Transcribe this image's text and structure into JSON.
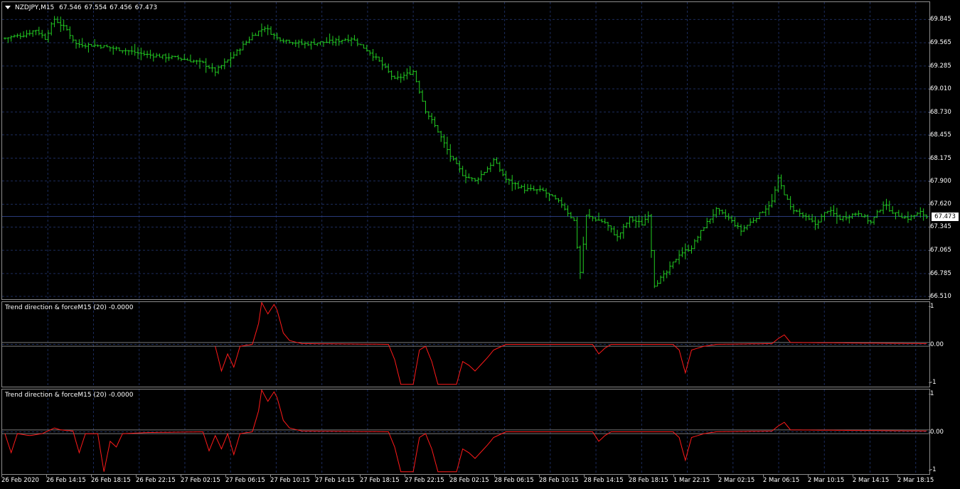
{
  "chart_header": {
    "symbol": "NZDJPY,M15",
    "open": "67.546",
    "high": "67.554",
    "low": "67.456",
    "close": "67.473"
  },
  "current_price": "67.473",
  "indicator_1": {
    "label": "Trend direction & forceM15 (20) -0.0000"
  },
  "indicator_2": {
    "label": "Trend direction & forceM15 (20) -0.0000"
  },
  "colors": {
    "background": "#000000",
    "grid": "#1c2c5c",
    "bars": "#22cc22",
    "indicator_line": "#ff1a1a",
    "level_line": "#7a7a7a",
    "price_line": "#2a3a7a"
  },
  "chart_data": [
    {
      "type": "ohlc",
      "symbol": "NZDJPY,M15",
      "ylim": [
        66.51,
        69.9
      ],
      "y_ticks": [
        "69.845",
        "69.565",
        "69.285",
        "69.010",
        "68.730",
        "68.455",
        "68.175",
        "67.900",
        "67.620",
        "67.345",
        "67.065",
        "66.785",
        "66.510"
      ],
      "x_ticks": [
        "26 Feb 2020",
        "26 Feb 14:15",
        "26 Feb 18:15",
        "26 Feb 22:15",
        "27 Feb 02:15",
        "27 Feb 06:15",
        "27 Feb 10:15",
        "27 Feb 14:15",
        "27 Feb 18:15",
        "27 Feb 22:15",
        "28 Feb 02:15",
        "28 Feb 06:15",
        "28 Feb 10:15",
        "28 Feb 14:15",
        "28 Feb 18:15",
        "1 Mar 22:15",
        "2 Mar 02:15",
        "2 Mar 06:15",
        "2 Mar 10:15",
        "2 Mar 14:15",
        "2 Mar 18:15"
      ],
      "close_path": [
        [
          0,
          69.62
        ],
        [
          6,
          69.66
        ],
        [
          10,
          69.72
        ],
        [
          13,
          69.62
        ],
        [
          16,
          69.85
        ],
        [
          20,
          69.72
        ],
        [
          23,
          69.55
        ],
        [
          30,
          69.53
        ],
        [
          38,
          69.48
        ],
        [
          46,
          69.42
        ],
        [
          56,
          69.38
        ],
        [
          64,
          69.32
        ],
        [
          68,
          69.22
        ],
        [
          74,
          69.42
        ],
        [
          80,
          69.65
        ],
        [
          84,
          69.75
        ],
        [
          88,
          69.62
        ],
        [
          96,
          69.55
        ],
        [
          106,
          69.58
        ],
        [
          112,
          69.62
        ],
        [
          118,
          69.45
        ],
        [
          122,
          69.3
        ],
        [
          126,
          69.12
        ],
        [
          132,
          69.22
        ],
        [
          136,
          68.75
        ],
        [
          140,
          68.5
        ],
        [
          144,
          68.2
        ],
        [
          148,
          67.98
        ],
        [
          152,
          67.9
        ],
        [
          156,
          68.05
        ],
        [
          158,
          68.15
        ],
        [
          162,
          67.92
        ],
        [
          168,
          67.8
        ],
        [
          174,
          67.78
        ],
        [
          180,
          67.62
        ],
        [
          184,
          67.42
        ],
        [
          186,
          66.8
        ],
        [
          188,
          67.48
        ],
        [
          194,
          67.4
        ],
        [
          198,
          67.22
        ],
        [
          202,
          67.45
        ],
        [
          206,
          67.38
        ],
        [
          208,
          67.5
        ],
        [
          210,
          66.65
        ],
        [
          214,
          66.8
        ],
        [
          218,
          67.02
        ],
        [
          222,
          67.1
        ],
        [
          226,
          67.35
        ],
        [
          230,
          67.55
        ],
        [
          234,
          67.45
        ],
        [
          238,
          67.3
        ],
        [
          244,
          67.5
        ],
        [
          248,
          67.65
        ],
        [
          250,
          67.92
        ],
        [
          254,
          67.58
        ],
        [
          258,
          67.48
        ],
        [
          262,
          67.38
        ],
        [
          266,
          67.55
        ],
        [
          270,
          67.45
        ],
        [
          276,
          67.52
        ],
        [
          280,
          67.4
        ],
        [
          284,
          67.62
        ],
        [
          288,
          67.5
        ],
        [
          292,
          67.45
        ],
        [
          296,
          67.52
        ],
        [
          298,
          67.47
        ]
      ],
      "bar_count": 299
    },
    {
      "type": "line",
      "name": "Trend direction & forceM15 (20)",
      "ylim": [
        -1,
        1
      ],
      "y_ticks": [
        "1",
        "0.00",
        "-1"
      ],
      "levels": [
        0.05,
        -0.05
      ],
      "values_path": [
        [
          68,
          -0.05
        ],
        [
          70,
          -0.7
        ],
        [
          72,
          -0.25
        ],
        [
          74,
          -0.6
        ],
        [
          76,
          -0.05
        ],
        [
          80,
          0.0
        ],
        [
          82,
          0.55
        ],
        [
          83,
          1.1
        ],
        [
          85,
          0.8
        ],
        [
          87,
          1.05
        ],
        [
          88,
          0.9
        ],
        [
          90,
          0.3
        ],
        [
          92,
          0.1
        ],
        [
          96,
          0.02
        ],
        [
          124,
          0.0
        ],
        [
          126,
          -0.4
        ],
        [
          128,
          -1.05
        ],
        [
          132,
          -1.05
        ],
        [
          134,
          -0.15
        ],
        [
          136,
          -0.05
        ],
        [
          138,
          -0.45
        ],
        [
          140,
          -1.05
        ],
        [
          142,
          -1.05
        ],
        [
          146,
          -1.05
        ],
        [
          148,
          -0.45
        ],
        [
          150,
          -0.55
        ],
        [
          152,
          -0.7
        ],
        [
          156,
          -0.35
        ],
        [
          158,
          -0.15
        ],
        [
          162,
          0.0
        ],
        [
          190,
          0.0
        ],
        [
          192,
          -0.25
        ],
        [
          194,
          -0.1
        ],
        [
          196,
          0.0
        ],
        [
          216,
          0.0
        ],
        [
          218,
          -0.15
        ],
        [
          220,
          -0.75
        ],
        [
          222,
          -0.15
        ],
        [
          226,
          -0.05
        ],
        [
          230,
          0.0
        ],
        [
          248,
          0.02
        ],
        [
          250,
          0.15
        ],
        [
          252,
          0.25
        ],
        [
          254,
          0.05
        ],
        [
          298,
          0.02
        ]
      ]
    },
    {
      "type": "line",
      "name": "Trend direction & forceM15 (20)",
      "ylim": [
        -1,
        1
      ],
      "y_ticks": [
        "1",
        "0.00",
        "-1"
      ],
      "levels": [
        0.05,
        -0.05
      ],
      "values_path": [
        [
          0,
          -0.05
        ],
        [
          2,
          -0.55
        ],
        [
          4,
          -0.05
        ],
        [
          8,
          -0.1
        ],
        [
          12,
          -0.05
        ],
        [
          16,
          0.1
        ],
        [
          18,
          0.05
        ],
        [
          22,
          0.02
        ],
        [
          24,
          -0.55
        ],
        [
          26,
          -0.05
        ],
        [
          30,
          -0.05
        ],
        [
          32,
          -1.05
        ],
        [
          34,
          -0.25
        ],
        [
          36,
          -0.4
        ],
        [
          38,
          -0.05
        ],
        [
          46,
          -0.02
        ],
        [
          64,
          0.0
        ],
        [
          66,
          -0.5
        ],
        [
          68,
          -0.1
        ],
        [
          70,
          -0.45
        ],
        [
          72,
          -0.05
        ],
        [
          74,
          -0.6
        ],
        [
          76,
          -0.05
        ],
        [
          80,
          0.0
        ],
        [
          82,
          0.55
        ],
        [
          83,
          1.1
        ],
        [
          85,
          0.8
        ],
        [
          87,
          1.05
        ],
        [
          88,
          0.9
        ],
        [
          90,
          0.3
        ],
        [
          92,
          0.1
        ],
        [
          96,
          0.02
        ],
        [
          124,
          0.0
        ],
        [
          126,
          -0.4
        ],
        [
          128,
          -1.05
        ],
        [
          132,
          -1.05
        ],
        [
          134,
          -0.15
        ],
        [
          136,
          -0.05
        ],
        [
          138,
          -0.45
        ],
        [
          140,
          -1.05
        ],
        [
          142,
          -1.05
        ],
        [
          146,
          -1.05
        ],
        [
          148,
          -0.45
        ],
        [
          150,
          -0.55
        ],
        [
          152,
          -0.7
        ],
        [
          156,
          -0.35
        ],
        [
          158,
          -0.15
        ],
        [
          162,
          0.0
        ],
        [
          190,
          0.0
        ],
        [
          192,
          -0.25
        ],
        [
          194,
          -0.1
        ],
        [
          196,
          0.0
        ],
        [
          216,
          0.0
        ],
        [
          218,
          -0.15
        ],
        [
          220,
          -0.75
        ],
        [
          222,
          -0.15
        ],
        [
          226,
          -0.05
        ],
        [
          230,
          0.0
        ],
        [
          248,
          0.02
        ],
        [
          250,
          0.15
        ],
        [
          252,
          0.25
        ],
        [
          254,
          0.05
        ],
        [
          298,
          0.02
        ]
      ]
    }
  ]
}
